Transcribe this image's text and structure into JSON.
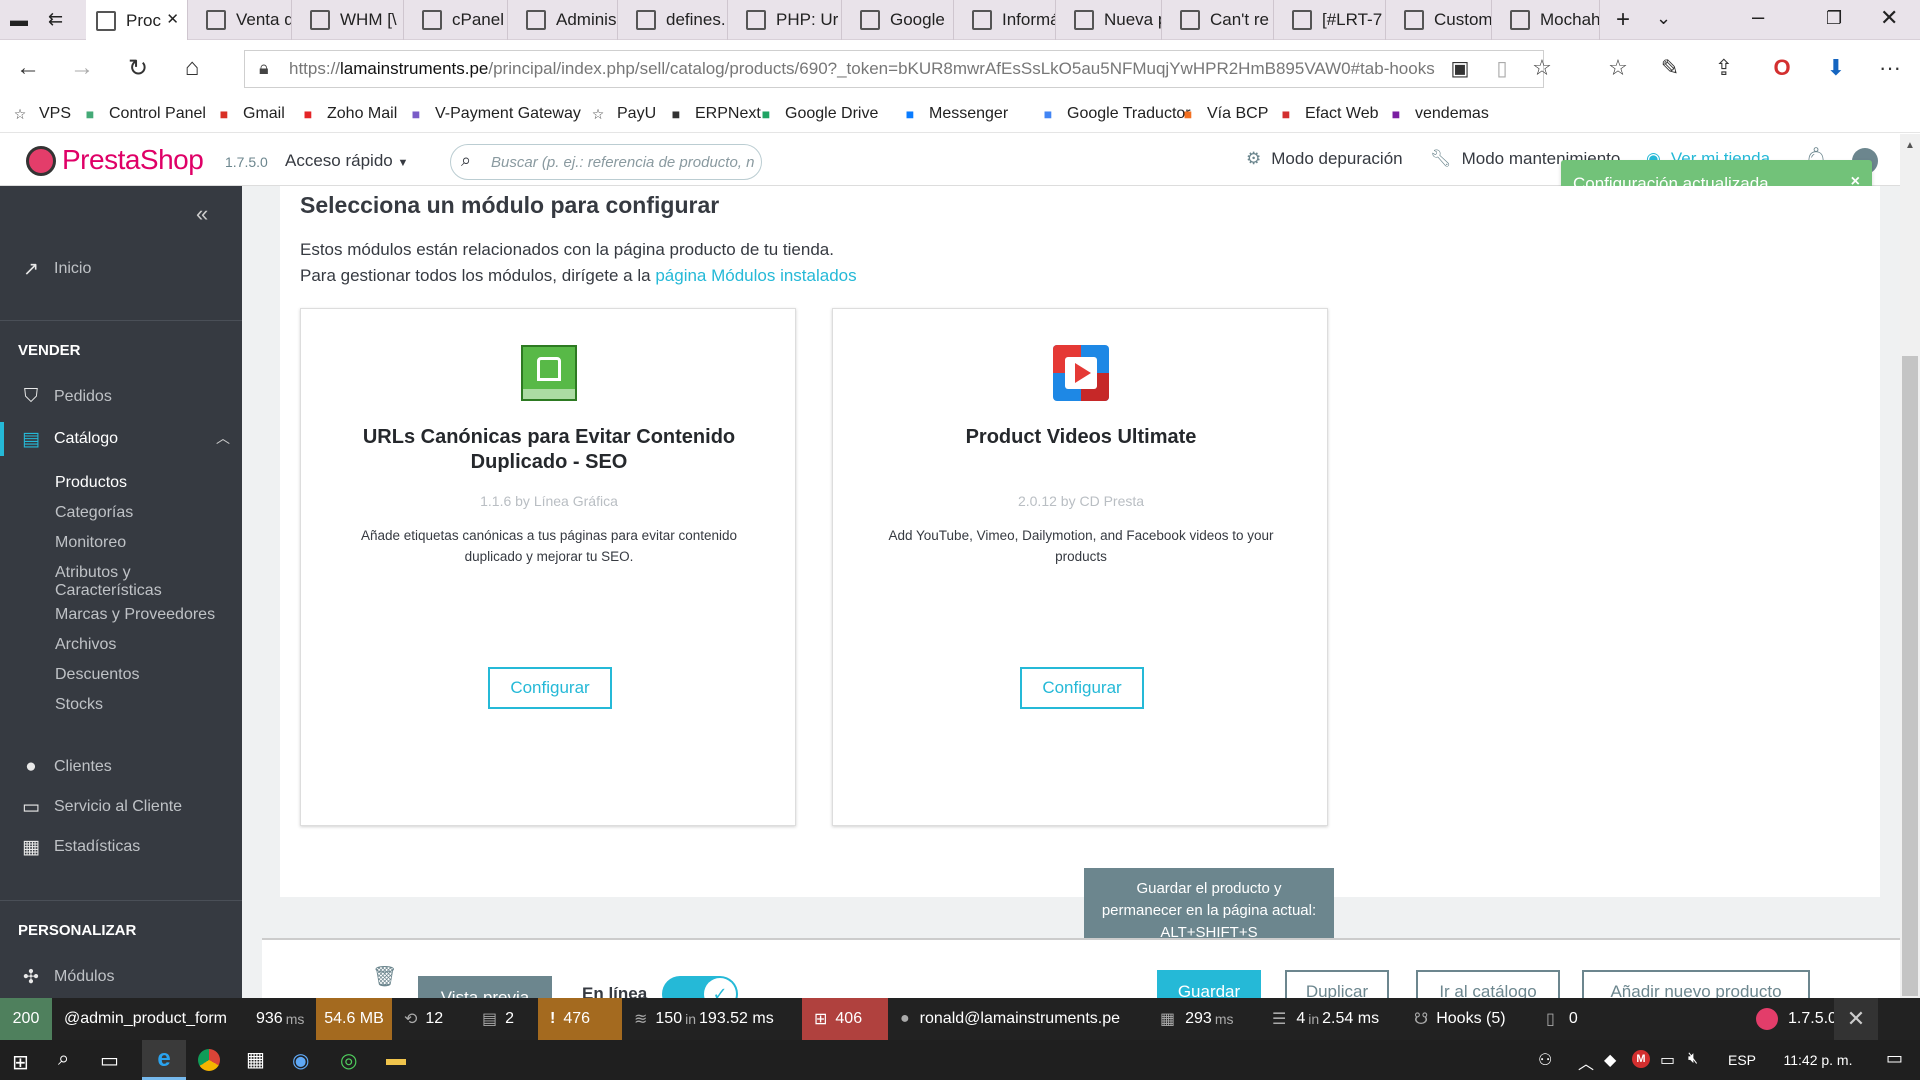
{
  "browser": {
    "tabs": [
      {
        "label": "Proc",
        "icon": "prestashop-icon"
      },
      {
        "label": "Venta d",
        "icon": "prestashop-icon"
      },
      {
        "label": "WHM [\\",
        "icon": "page-icon"
      },
      {
        "label": "cPanel -",
        "icon": "page-icon"
      },
      {
        "label": "Adminis",
        "icon": "page-icon"
      },
      {
        "label": "defines.",
        "icon": "page-icon"
      },
      {
        "label": "PHP: Ur",
        "icon": "php-icon"
      },
      {
        "label": "Google",
        "icon": "google-translate-icon"
      },
      {
        "label": "Informá",
        "icon": "info-icon"
      },
      {
        "label": "Nueva p",
        "icon": "new-page-icon"
      },
      {
        "label": "Can't re",
        "icon": "page-icon"
      },
      {
        "label": "[#LRT-7",
        "icon": "gmail-icon"
      },
      {
        "label": "Custom",
        "icon": "custom-icon"
      },
      {
        "label": "Mochah",
        "icon": "mocha-icon"
      }
    ],
    "url_domain": "lamainstruments.pe",
    "url_prefix": "https://",
    "url_rest": "/principal/index.php/sell/catalog/products/690?_token=bKUR8mwrAfEsSsLkO5au5NFMuqjYwHPR2HmB895VAW0#tab-hooks",
    "favorites": [
      {
        "label": "VPS",
        "icon": "star-icon",
        "color": "#444"
      },
      {
        "label": "Control Panel",
        "icon": "control-panel-icon",
        "color": "#4a7"
      },
      {
        "label": "Gmail",
        "icon": "gmail-icon",
        "color": "#d93025"
      },
      {
        "label": "Zoho Mail",
        "icon": "zoho-icon",
        "color": "#e42527"
      },
      {
        "label": "V-Payment Gateway",
        "icon": "vpayment-icon",
        "color": "#7a5cc7"
      },
      {
        "label": "PayU",
        "icon": "star-icon",
        "color": "#444"
      },
      {
        "label": "ERPNext",
        "icon": "erpnext-icon",
        "color": "#333"
      },
      {
        "label": "Google Drive",
        "icon": "google-drive-icon",
        "color": "#1fa463"
      },
      {
        "label": "Messenger",
        "icon": "messenger-icon",
        "color": "#0a7cff"
      },
      {
        "label": "Google Traductor",
        "icon": "translate-icon",
        "color": "#4285f4"
      },
      {
        "label": "Vía BCP",
        "icon": "bcp-icon",
        "color": "#f37021"
      },
      {
        "label": "Efact Web",
        "icon": "efact-icon",
        "color": "#d32f2f"
      },
      {
        "label": "vendemas",
        "icon": "vendemas-icon",
        "color": "#7b1fa2"
      }
    ]
  },
  "header": {
    "brand": "PrestaShop",
    "version": "1.7.5.0",
    "quick_access": "Acceso rápido",
    "search_placeholder": "Buscar (p. ej.: referencia de producto, n",
    "debug_mode": "Modo depuración",
    "maintenance_mode": "Modo mantenimiento",
    "view_store": "Ver mi tienda"
  },
  "toast": {
    "message": "Configuración actualizada.",
    "close": "×",
    "color": "#72c279"
  },
  "sidebar": {
    "collapse": "«",
    "home": "Inicio",
    "sell_heading": "VENDER",
    "orders": "Pedidos",
    "catalog": "Catálogo",
    "catalog_sub": [
      "Productos",
      "Categorías",
      "Monitoreo",
      "Atributos y Características",
      "Marcas y Proveedores",
      "Archivos",
      "Descuentos",
      "Stocks"
    ],
    "customers": "Clientes",
    "customer_service": "Servicio al Cliente",
    "stats": "Estadísticas",
    "customize_heading": "PERSONALIZAR",
    "modules": "Módulos"
  },
  "main": {
    "title": "Selecciona un módulo para configurar",
    "intro1": "Estos módulos están relacionados con la página producto de tu tienda.",
    "intro2": "Para gestionar todos los módulos, dirígete a la",
    "intro_link": "página Módulos instalados",
    "modules": [
      {
        "name": "URLs Canónicas para Evitar Contenido Duplicado - SEO",
        "version": "1.1.6 by Línea Gráfica",
        "description": "Añade etiquetas canónicas a tus páginas para evitar contenido duplicado y mejorar tu SEO.",
        "button": "Configurar"
      },
      {
        "name": "Product Videos Ultimate",
        "version": "2.0.12 by CD Presta",
        "description": "Add YouTube, Vimeo, Dailymotion, and Facebook videos to your products",
        "button": "Configurar"
      }
    ]
  },
  "tooltip": "Guardar el producto y permanecer en la página actual: ALT+SHIFT+S",
  "footer": {
    "preview": "Vista previa",
    "online": "En línea",
    "save": "Guardar",
    "duplicate": "Duplicar",
    "go_catalog": "Ir al catálogo",
    "add_new": "Añadir nuevo producto"
  },
  "debugbar": {
    "status": "200",
    "route": "@admin_product_form",
    "time_value": "936",
    "time_unit": "ms",
    "memory": "54.6 MB",
    "forms": "12",
    "templates": "2",
    "errors": "476",
    "queries_count": "150",
    "queries_in": "in",
    "queries_time": "193.52 ms",
    "translations": "406",
    "user": "ronald@lamainstruments.pe",
    "render_time": "293",
    "render_unit": "ms",
    "cache_count": "4",
    "cache_in": "in",
    "cache_time": "2.54 ms",
    "hooks": "Hooks (5)",
    "other": "0",
    "version": "1.7.5.0"
  },
  "taskbar": {
    "lang": "ESP",
    "time": "11:42 p. m."
  }
}
